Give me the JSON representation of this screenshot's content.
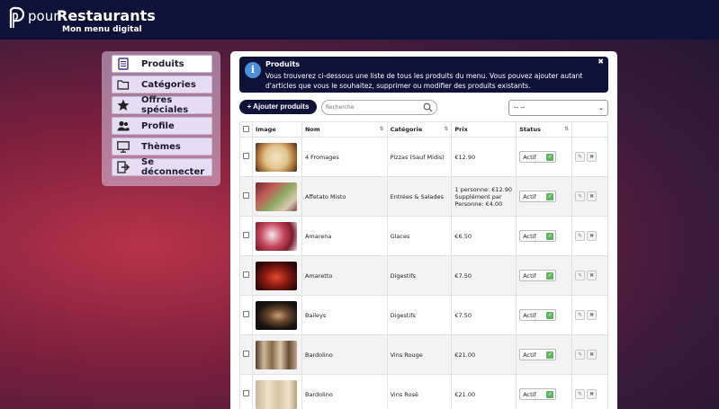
{
  "header": {
    "brand_pre": "pour",
    "brand_main": "Restaurants",
    "subtitle": "Mon menu digital"
  },
  "menu": {
    "items": [
      {
        "label": "Produits",
        "icon": "document-icon",
        "active": true
      },
      {
        "label": "Catégories",
        "icon": "folder-icon",
        "active": false
      },
      {
        "label": "Offres spéciales",
        "icon": "star-icon",
        "active": false
      },
      {
        "label": "Profile",
        "icon": "users-icon",
        "active": false
      },
      {
        "label": "Thèmes",
        "icon": "monitor-icon",
        "active": false
      },
      {
        "label": "Se déconnecter",
        "icon": "logout-icon",
        "active": false
      }
    ]
  },
  "info": {
    "title": "Produits",
    "text": "Vous trouverez ci-dessous une liste de tous les produits du menu. Vous pouvez ajouter autant d'articles que vous le souhaitez, supprimer ou modifier des produits existants.",
    "close": "✖"
  },
  "toolbar": {
    "add_label": "+ Ajouter produits",
    "search_placeholder": "Recherche",
    "filter_value": "-- --"
  },
  "table": {
    "headers": {
      "image": "Image",
      "name": "Nom",
      "category": "Catégorie",
      "price": "Prix",
      "status": "Status"
    },
    "rows": [
      {
        "name": "4 Fromages",
        "category": "Pizzas (Sauf Midis)",
        "price": "€12.90",
        "status": "Actif"
      },
      {
        "name": "Affetato Misto",
        "category": "Entrées & Salades",
        "price": "1 personne: €12.90 Supplément par Personne: €4.00",
        "status": "Actif"
      },
      {
        "name": "Amarena",
        "category": "Glaces",
        "price": "€6.50",
        "status": "Actif"
      },
      {
        "name": "Amaretto",
        "category": "Digestifs",
        "price": "€7.50",
        "status": "Actif"
      },
      {
        "name": "Baileys",
        "category": "Digestifs",
        "price": "€7.50",
        "status": "Actif"
      },
      {
        "name": "Bardolino",
        "category": "Vins Rouge",
        "price": "€21.00",
        "status": "Actif"
      },
      {
        "name": "Bardolino",
        "category": "Vins Rosé",
        "price": "€21.00",
        "status": "Actif"
      }
    ]
  },
  "colors": {
    "navy": "#0f1238",
    "check_green": "#5cb85c",
    "info_blue": "#4a90d9"
  }
}
